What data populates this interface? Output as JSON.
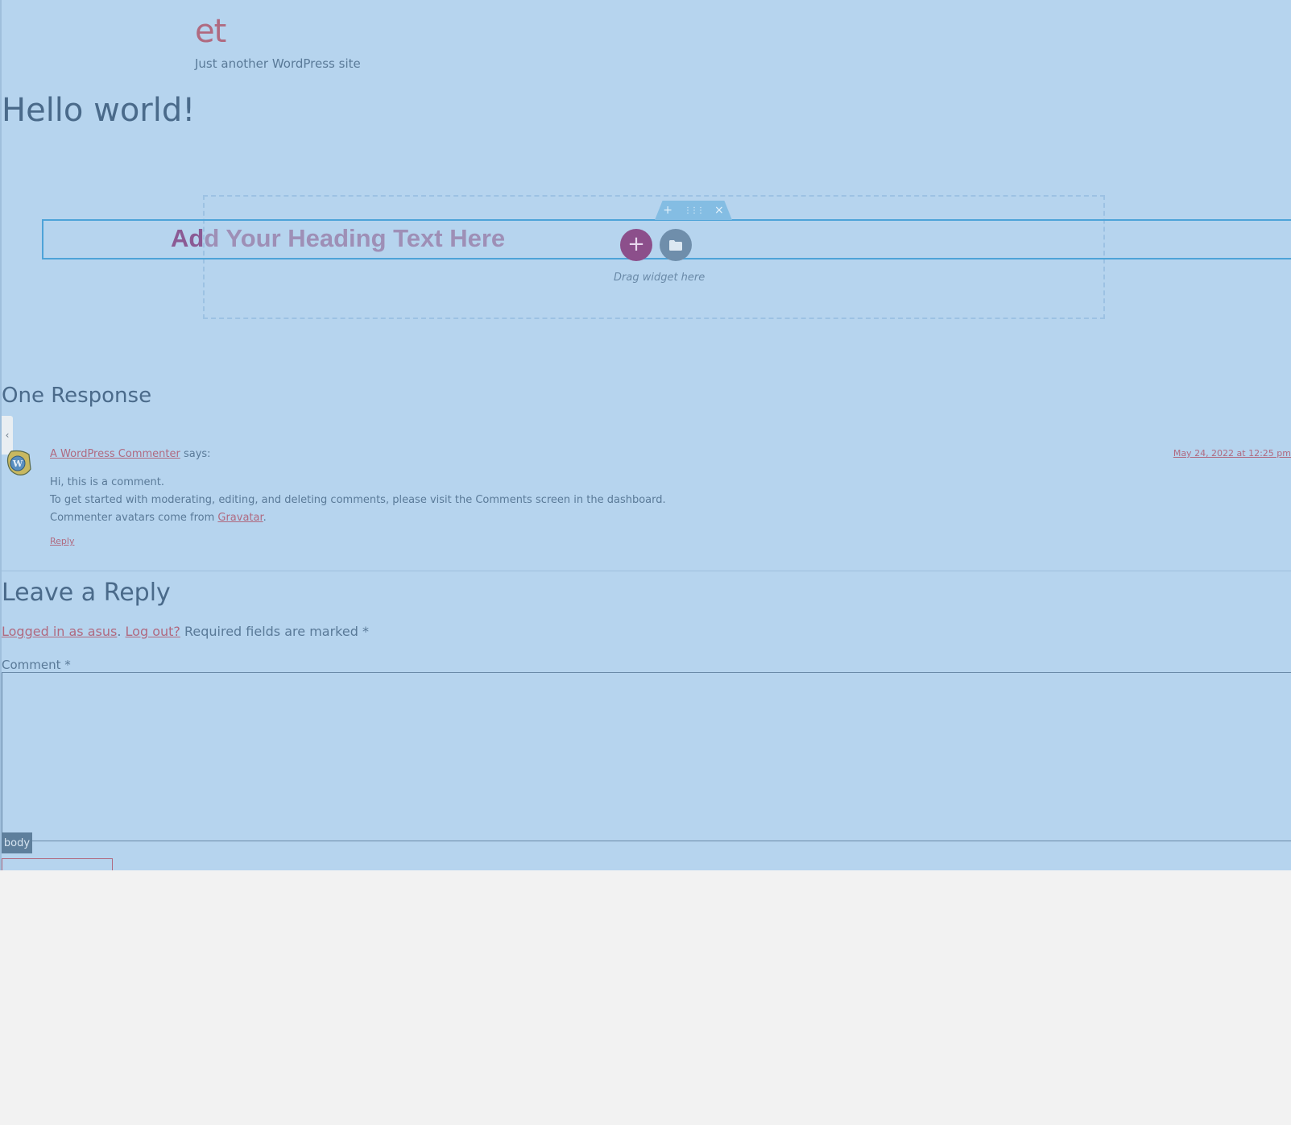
{
  "site": {
    "title": "et",
    "description": "Just another WordPress site"
  },
  "post": {
    "title": "Hello world!"
  },
  "editor": {
    "heading_placeholder_dark": "Ad",
    "heading_placeholder_light": "d Your Heading Text Here",
    "handle_add": "+",
    "handle_move": "⋮⋮⋮",
    "handle_close": "×",
    "add_button": "+",
    "drag_text": "Drag widget here",
    "body_badge": "body"
  },
  "comments": {
    "title": "One Response",
    "items": [
      {
        "author": "A WordPress Commenter",
        "says": "says:",
        "date": "May 24, 2022 at 12:25 pm",
        "lines": [
          "Hi, this is a comment.",
          "To get started with moderating, editing, and deleting comments, please visit the Comments screen in the dashboard."
        ],
        "line3_prefix": "Commenter avatars come from ",
        "line3_link": "Gravatar",
        "line3_suffix": ".",
        "reply": "Reply"
      }
    ]
  },
  "reply_form": {
    "title": "Leave a Reply",
    "logged_in": "Logged in as asus",
    "sep": ".",
    "logout": "Log out?",
    "required_text": "Required fields are marked *",
    "comment_label": "Comment *",
    "comment_value": ""
  },
  "colors": {
    "overlay": "#b6d4ee",
    "accent_link": "#b06a80",
    "add_button": "#8c4f8b",
    "widget_border": "#4da3d8"
  }
}
